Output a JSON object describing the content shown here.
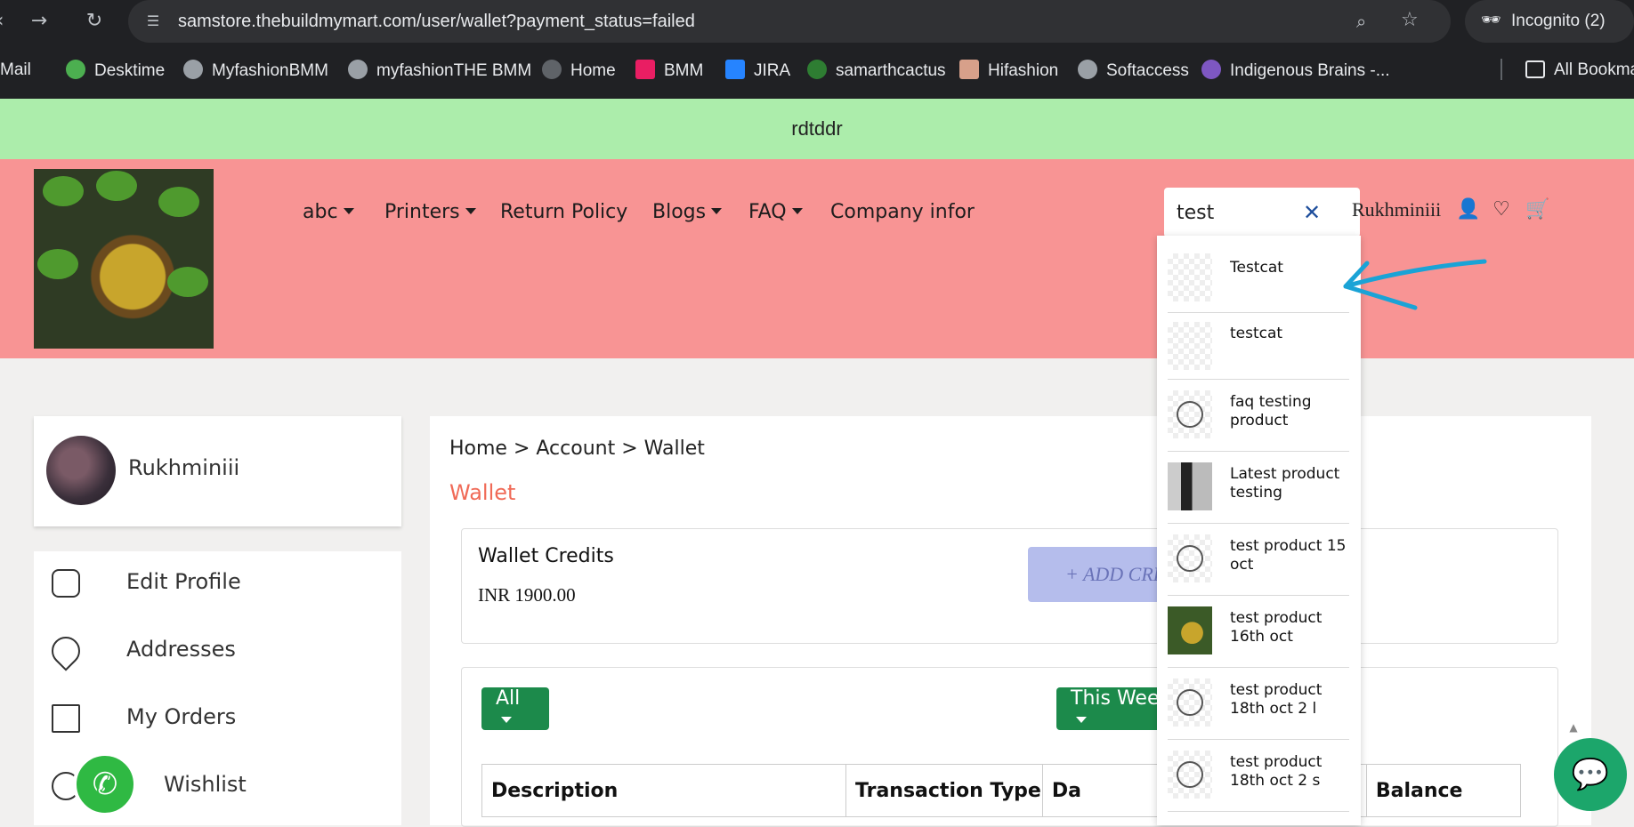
{
  "browser": {
    "url": "samstore.thebuildmymart.com/user/wallet?payment_status=failed",
    "incognito_label": "Incognito (2)",
    "bookmarks": [
      {
        "label": "Mail"
      },
      {
        "label": "Desktime"
      },
      {
        "label": "MyfashionBMM"
      },
      {
        "label": "myfashionTHE BMM"
      },
      {
        "label": "Home"
      },
      {
        "label": "BMM"
      },
      {
        "label": "JIRA"
      },
      {
        "label": "samarthcactus"
      },
      {
        "label": "Hifashion"
      },
      {
        "label": "Softaccess"
      },
      {
        "label": "Indigenous Brains -..."
      }
    ],
    "all_bookmarks": "All Bookma"
  },
  "announcement": "rdtddr",
  "header": {
    "nav": [
      {
        "label": "abc",
        "has_dropdown": true
      },
      {
        "label": "Printers",
        "has_dropdown": true
      },
      {
        "label": "Return Policy",
        "has_dropdown": false
      },
      {
        "label": "Blogs",
        "has_dropdown": true
      },
      {
        "label": "FAQ",
        "has_dropdown": true
      },
      {
        "label": "Company infor",
        "has_dropdown": false
      }
    ],
    "search_value": "test",
    "clear_symbol": "✕",
    "user_name": "Rukhminiii"
  },
  "search_results": [
    {
      "name": "Testcat",
      "thumb": "sketch"
    },
    {
      "name": "testcat",
      "thumb": "sketch"
    },
    {
      "name": "faq testing product",
      "thumb": "person"
    },
    {
      "name": "Latest product testing",
      "thumb": "dark"
    },
    {
      "name": "test product 15 oct",
      "thumb": "person"
    },
    {
      "name": "test product 16th oct",
      "thumb": "photo"
    },
    {
      "name": "test product 18th oct 2 l",
      "thumb": "person"
    },
    {
      "name": "test product 18th oct 2 s",
      "thumb": "person"
    }
  ],
  "sidebar": {
    "profile_name": "Rukhminiii",
    "menu": [
      {
        "label": "Edit Profile"
      },
      {
        "label": "Addresses"
      },
      {
        "label": "My Orders"
      },
      {
        "label": "Wishlist"
      }
    ]
  },
  "main": {
    "breadcrumb": "Home > Account > Wallet",
    "title": "Wallet",
    "wallet_label": "Wallet Credits",
    "wallet_amount": "INR 1900.00",
    "add_credit_label": "+ ADD CRE",
    "filter_all": "All",
    "filter_period": "This Week",
    "table_headers": [
      "Description",
      "Transaction Type",
      "Da",
      "",
      "Balance"
    ]
  },
  "colors": {
    "announcement_bg": "#acedab",
    "header_bg": "#f89494",
    "title_accent": "#f06a57",
    "button_green": "#1c8a4b",
    "add_credit_bg": "#b5bdec",
    "annotation_arrow": "#1aa3d6"
  }
}
